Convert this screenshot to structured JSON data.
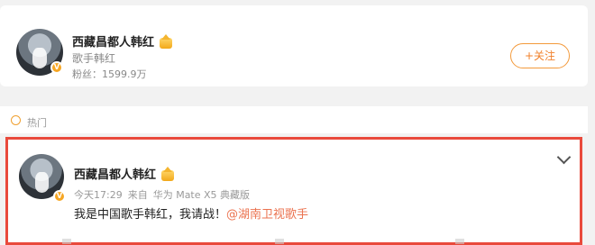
{
  "profile_card": {
    "name": "西藏昌都人韩红",
    "title": "歌手韩红",
    "fans_label": "粉丝：",
    "fans_count": "1599.9万",
    "follow_label": "+关注",
    "verify_badge": "V"
  },
  "hot_section": {
    "label": "热门",
    "icon": "hot-icon"
  },
  "post": {
    "author": "西藏昌都人韩红",
    "time": "今天17:29",
    "source_prefix": "来自",
    "source": "华为 Mate X5 典藏版",
    "text": "我是中国歌手韩红，我请战！",
    "mention": "@湖南卫视歌手",
    "verify_badge": "V"
  },
  "colors": {
    "accent": "#f0802a",
    "highlight_border": "#e94a3c",
    "mention": "#eb7350"
  }
}
